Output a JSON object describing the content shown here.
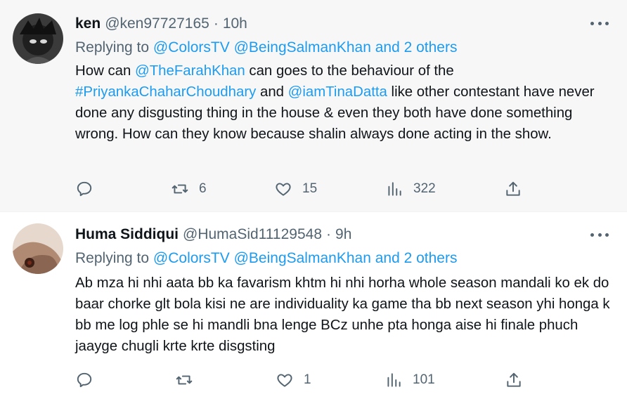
{
  "tweets": [
    {
      "name": "ken",
      "handle": "@ken97727165",
      "separator": "·",
      "time": "10h",
      "replying_prefix": "Replying to ",
      "replying_targets": [
        "@ColorsTV",
        "@BeingSalmanKhan",
        "and 2 others"
      ],
      "text_parts": [
        {
          "t": "How can ",
          "link": false
        },
        {
          "t": "@TheFarahKhan",
          "link": true
        },
        {
          "t": " can goes to the behaviour of the ",
          "link": false
        },
        {
          "t": "#PriyankaChaharChoudhary",
          "link": true
        },
        {
          "t": " and ",
          "link": false
        },
        {
          "t": "@iamTinaDatta",
          "link": true
        },
        {
          "t": " like other contestant have never done any disgusting thing in the house & even they both have done something wrong. How can they know because shalin always done acting in the show.",
          "link": false
        }
      ],
      "actions": {
        "reply": "",
        "retweet": "6",
        "like": "15",
        "views": "322"
      }
    },
    {
      "name": "Huma Siddiqui",
      "handle": "@HumaSid11129548",
      "separator": "·",
      "time": "9h",
      "replying_prefix": "Replying to ",
      "replying_targets": [
        "@ColorsTV",
        "@BeingSalmanKhan",
        "and 2 others"
      ],
      "text_parts": [
        {
          "t": "Ab mza hi nhi aata bb ka favarism khtm hi nhi horha whole season mandali ko ek do baar chorke glt bola kisi ne are individuality ka game tha bb next season yhi honga k bb me log phle se hi mandli bna lenge BCz unhe pta honga aise hi finale phuch jaayge chugli krte krte disgsting",
          "link": false
        }
      ],
      "actions": {
        "reply": "",
        "retweet": "",
        "like": "1",
        "views": "101"
      }
    }
  ],
  "colors": {
    "link": "#1d9bf0",
    "muted": "#536471",
    "text": "#0f1419",
    "highlight_bg": "#f7f7f7"
  }
}
